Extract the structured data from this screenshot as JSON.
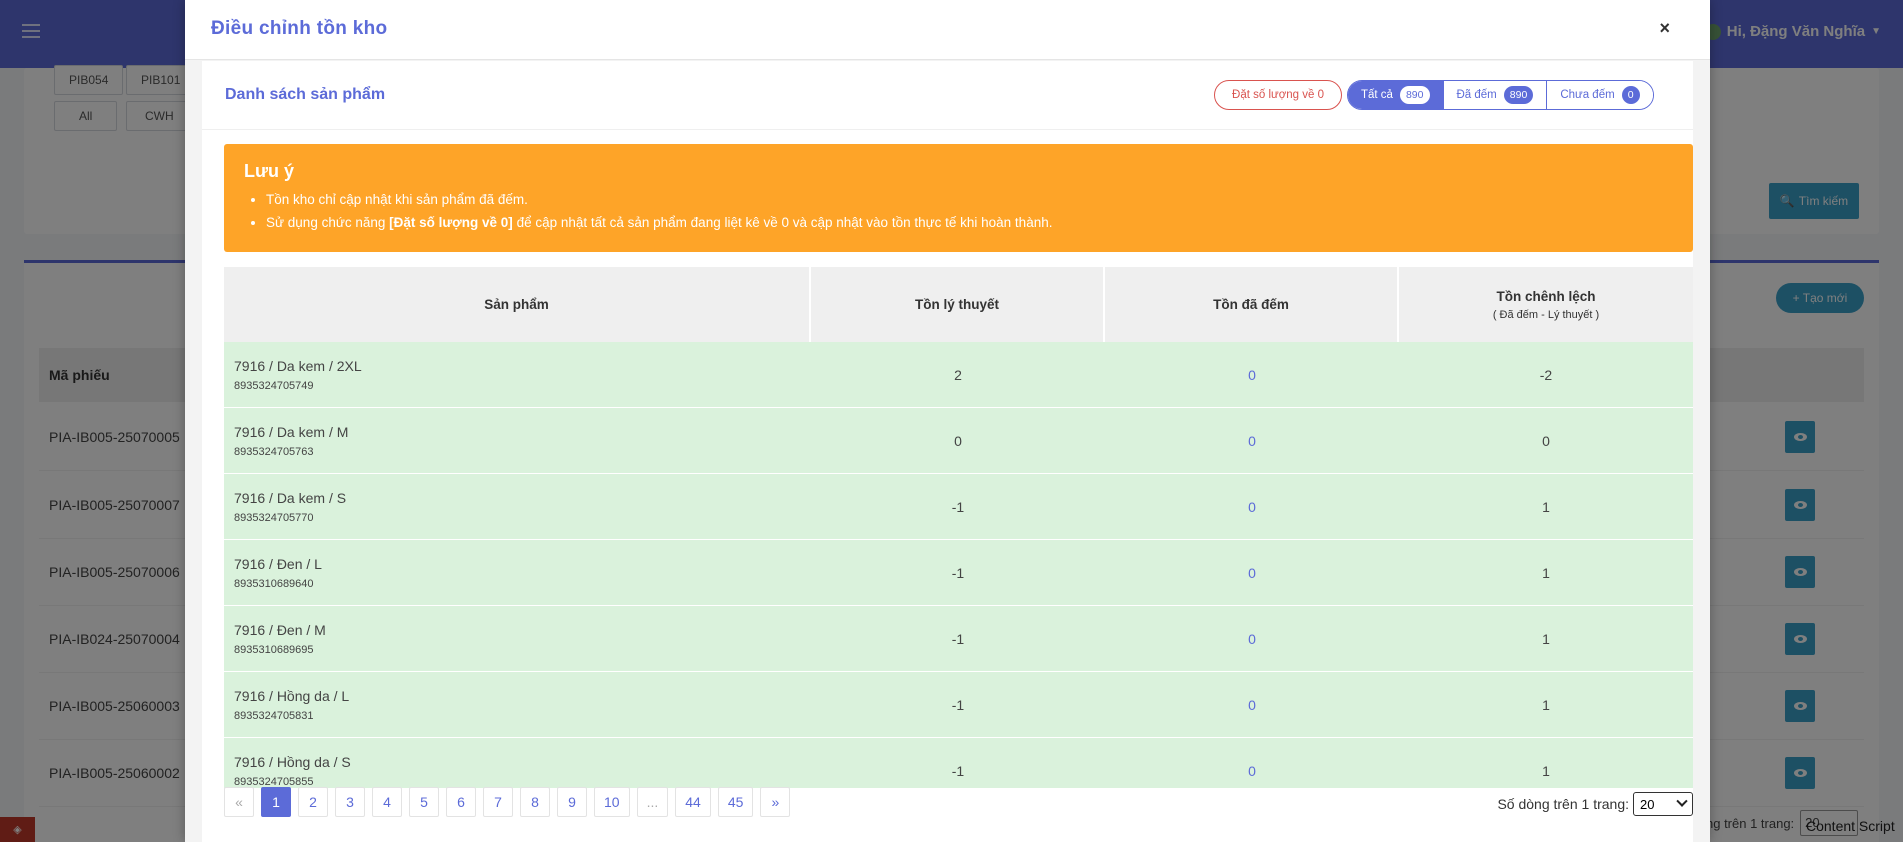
{
  "background": {
    "user_greeting": "Hi, Đặng Văn Nghĩa",
    "filter_chips_row1": [
      "PIB054",
      "PIB101"
    ],
    "filter_chips_row2": [
      "All",
      "CWH"
    ],
    "search_label": "Tìm kiếm",
    "create_label": "+ Tạo mới",
    "column_header": "Mã phiếu",
    "rows": [
      "PIA-IB005-25070005",
      "PIA-IB005-25070007",
      "PIA-IB005-25070006",
      "PIA-IB024-25070004",
      "PIA-IB005-25060003",
      "PIA-IB005-25060002"
    ],
    "rows_per_page_label": "ng trên 1 trang:",
    "rows_per_page_value": "20",
    "content_script": "Content Script"
  },
  "modal": {
    "title": "Điều chỉnh tồn kho",
    "close_symbol": "×",
    "list_title": "Danh sách sản phẩm",
    "reset_label": "Đặt số lượng về 0",
    "tabs": [
      {
        "label": "Tất cả",
        "count": "890"
      },
      {
        "label": "Đã đếm",
        "count": "890"
      },
      {
        "label": "Chưa đếm",
        "count": "0"
      }
    ],
    "note": {
      "title": "Lưu ý",
      "line1": "Tồn kho chỉ cập nhật khi sản phẩm đã đếm.",
      "line2_prefix": "Sử dụng chức năng ",
      "line2_bold": "[Đặt số lượng về 0]",
      "line2_suffix": " để cập nhật tất cả sản phẩm đang liệt kê về 0 và cập nhật vào tồn thực tế khi hoàn thành."
    },
    "table": {
      "headers": {
        "product": "Sản phẩm",
        "theoretical": "Tồn lý thuyết",
        "counted": "Tồn đã đếm",
        "difference": "Tồn chênh lệch",
        "difference_sub": "( Đã đếm - Lý thuyết )"
      },
      "rows": [
        {
          "name": "7916 / Da kem / 2XL",
          "code": "8935324705749",
          "theoretical": "2",
          "counted": "0",
          "difference": "-2"
        },
        {
          "name": "7916 / Da kem / M",
          "code": "8935324705763",
          "theoretical": "0",
          "counted": "0",
          "difference": "0"
        },
        {
          "name": "7916 / Da kem / S",
          "code": "8935324705770",
          "theoretical": "-1",
          "counted": "0",
          "difference": "1"
        },
        {
          "name": "7916 / Đen / L",
          "code": "8935310689640",
          "theoretical": "-1",
          "counted": "0",
          "difference": "1"
        },
        {
          "name": "7916 / Đen / M",
          "code": "8935310689695",
          "theoretical": "-1",
          "counted": "0",
          "difference": "1"
        },
        {
          "name": "7916 / Hồng da / L",
          "code": "8935324705831",
          "theoretical": "-1",
          "counted": "0",
          "difference": "1"
        },
        {
          "name": "7916 / Hồng da / S",
          "code": "8935324705855",
          "theoretical": "-1",
          "counted": "0",
          "difference": "1"
        }
      ]
    },
    "pagination": {
      "prev": "«",
      "pages": [
        "1",
        "2",
        "3",
        "4",
        "5",
        "6",
        "7",
        "8",
        "9",
        "10",
        "...",
        "44",
        "45"
      ],
      "next": "»",
      "current": "1",
      "per_page_label": "Số dòng trên 1 trang:",
      "per_page_value": "20"
    }
  },
  "colors": {
    "primary": "#5c6bd8",
    "warning": "#fea428",
    "danger": "#d9534f",
    "row_bg": "#daf2dc",
    "info": "#3aa0c9"
  }
}
